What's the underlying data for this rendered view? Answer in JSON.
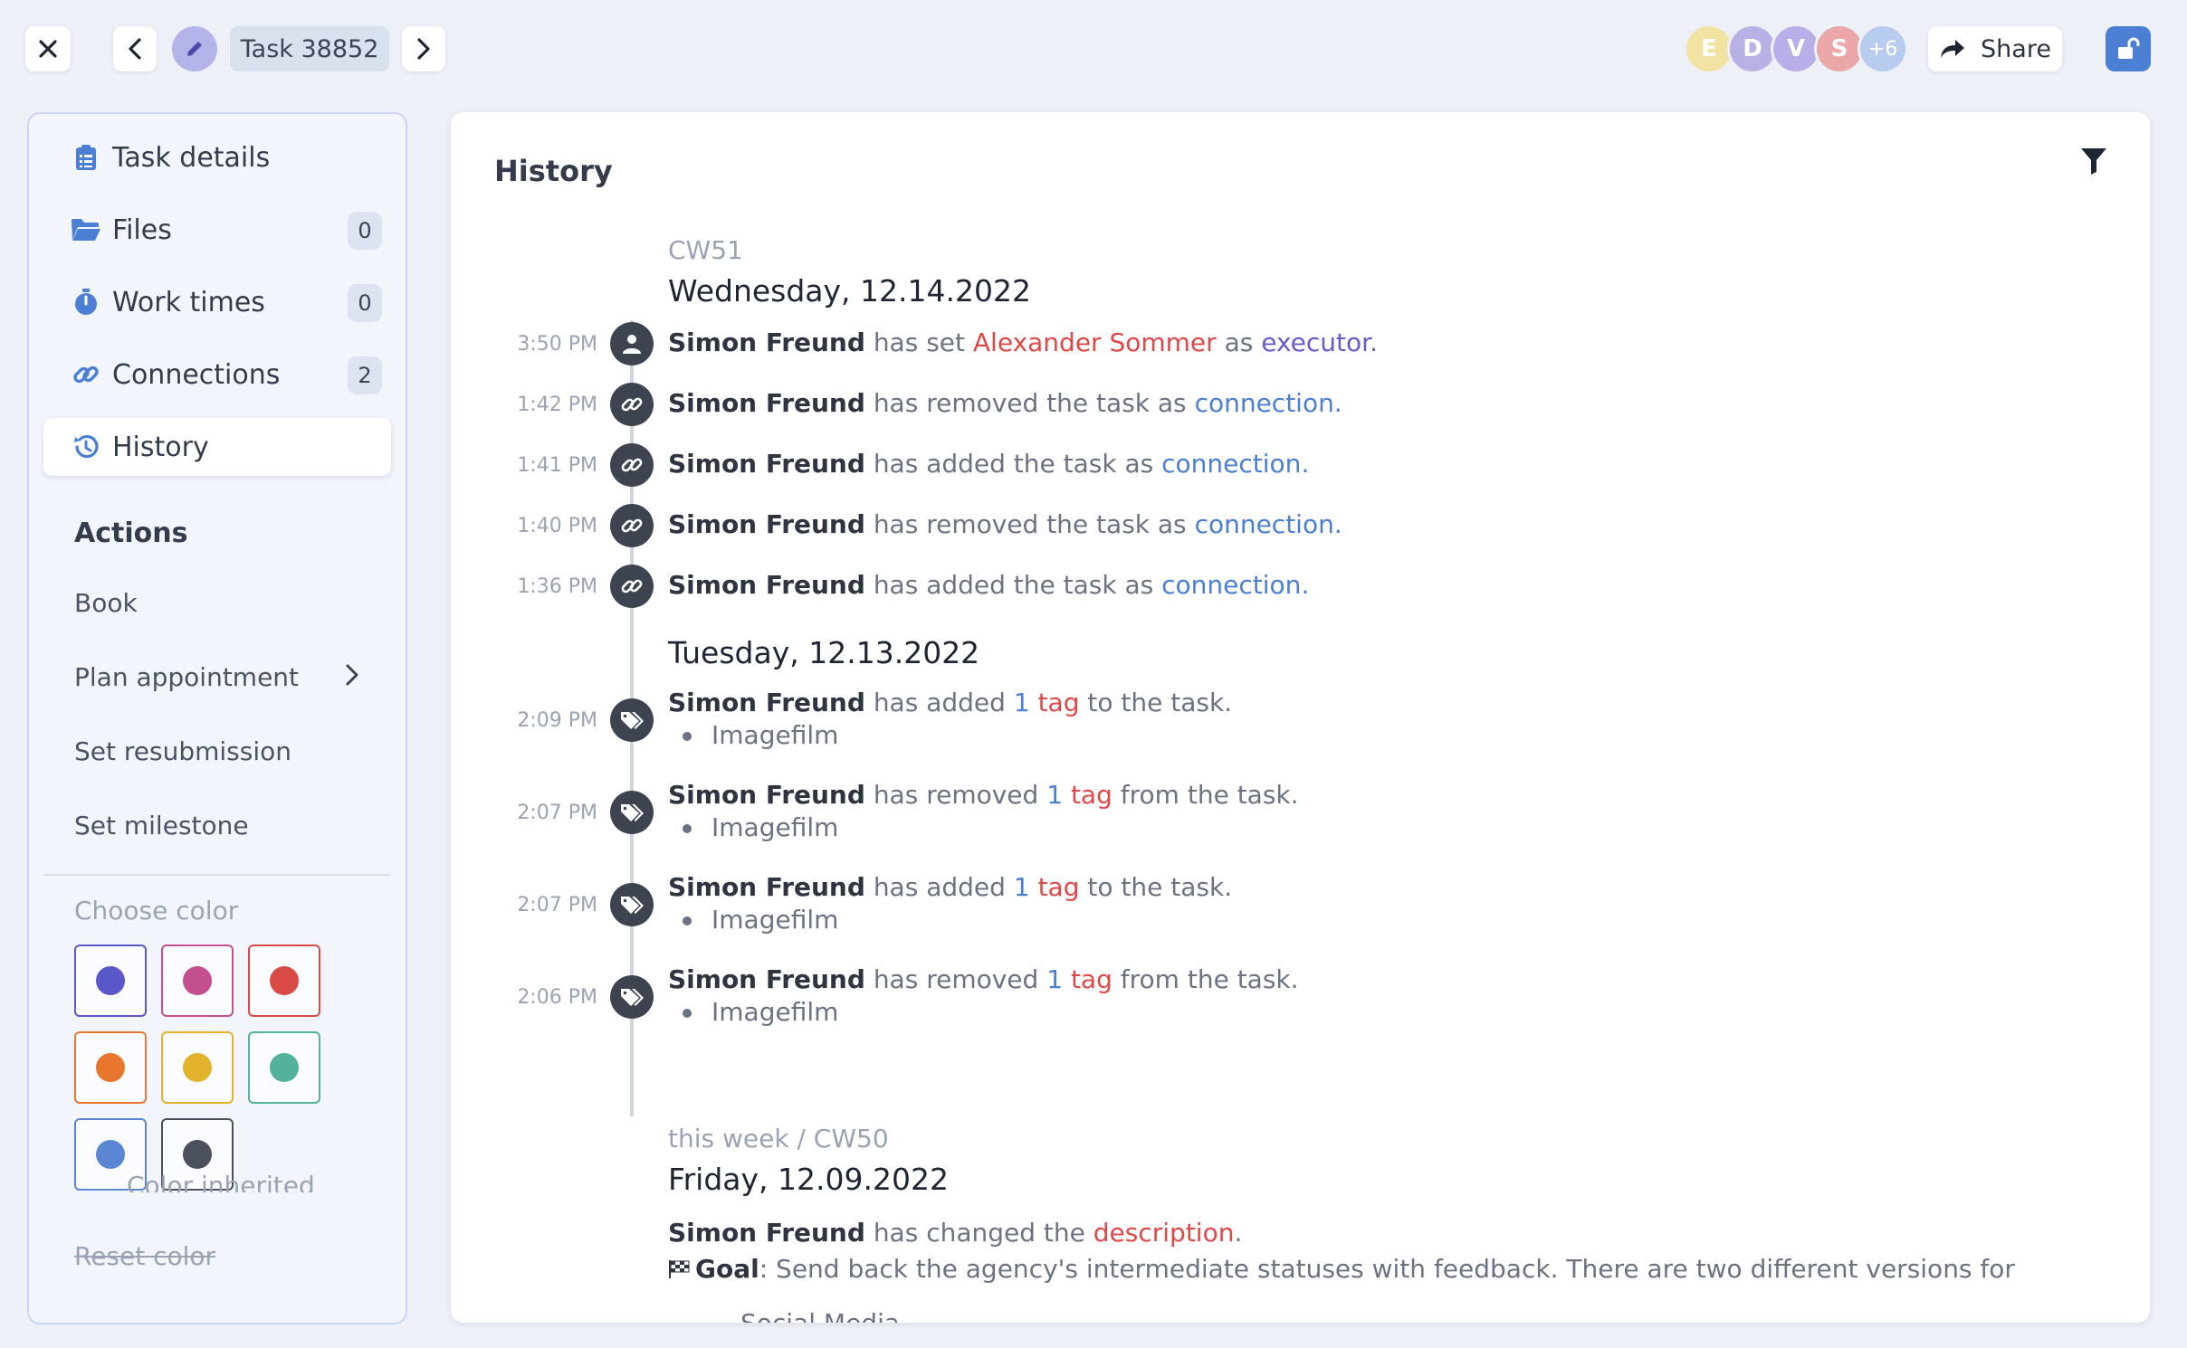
{
  "header": {
    "task_label": "Task 38852",
    "share_label": "Share",
    "avatars": [
      {
        "initial": "E",
        "color": "#f3e3a3"
      },
      {
        "initial": "D",
        "color": "#b8b1e6"
      },
      {
        "initial": "V",
        "color": "#b9aee8"
      },
      {
        "initial": "S",
        "color": "#eba7a7"
      },
      {
        "initial": "+6",
        "color": "#b8ccf0"
      }
    ]
  },
  "sidebar": {
    "nav": [
      {
        "label": "Task details",
        "count": null,
        "icon": "clipboard-icon"
      },
      {
        "label": "Files",
        "count": "0",
        "icon": "folder-icon"
      },
      {
        "label": "Work times",
        "count": "0",
        "icon": "stopwatch-icon"
      },
      {
        "label": "Connections",
        "count": "2",
        "icon": "link-icon"
      },
      {
        "label": "History",
        "count": null,
        "icon": "history-icon",
        "active": true
      }
    ],
    "actions_heading": "Actions",
    "actions": [
      "Book",
      "Plan appointment",
      "Set resubmission",
      "Set milestone"
    ],
    "choose_color_label": "Choose color",
    "colors": [
      "#5a57c9",
      "#c44f8f",
      "#d94a44",
      "#e9762e",
      "#e3b22d",
      "#52b39a",
      "#5b86d4",
      "#4a515c"
    ],
    "color_inherited_label": "Color inherited",
    "reset_color_label": "Reset color"
  },
  "main": {
    "title": "History",
    "groups": [
      {
        "week": "CW51",
        "days": [
          {
            "date": "Wednesday, 12.14.2022",
            "events": [
              {
                "time": "3:50 PM",
                "actor": "Simon Freund",
                "t1": "has set",
                "name": "Alexander Sommer",
                "t2": "as",
                "target": "executor",
                "end": "."
              },
              {
                "time": "1:42 PM",
                "actor": "Simon Freund",
                "t1": "has removed the task as",
                "target": "connection",
                "end": "."
              },
              {
                "time": "1:41 PM",
                "actor": "Simon Freund",
                "t1": "has added the task as",
                "target": "connection",
                "end": "."
              },
              {
                "time": "1:40 PM",
                "actor": "Simon Freund",
                "t1": "has removed the task as",
                "target": "connection",
                "end": "."
              },
              {
                "time": "1:36 PM",
                "actor": "Simon Freund",
                "t1": "has added the task as",
                "target": "connection",
                "end": "."
              }
            ]
          },
          {
            "date": "Tuesday, 12.13.2022",
            "events": [
              {
                "time": "2:09 PM",
                "actor": "Simon Freund",
                "t1": "has added",
                "num": "1",
                "word": "tag",
                "t2": "to the task.",
                "item": "Imagefilm"
              },
              {
                "time": "2:07 PM",
                "actor": "Simon Freund",
                "t1": "has removed",
                "num": "1",
                "word": "tag",
                "t2": "from the task.",
                "item": "Imagefilm"
              },
              {
                "time": "2:07 PM",
                "actor": "Simon Freund",
                "t1": "has added",
                "num": "1",
                "word": "tag",
                "t2": "to the task.",
                "item": "Imagefilm"
              },
              {
                "time": "2:06 PM",
                "actor": "Simon Freund",
                "t1": "has removed",
                "num": "1",
                "word": "tag",
                "t2": "from the task.",
                "item": "Imagefilm"
              }
            ]
          }
        ]
      },
      {
        "week": "this week / CW50",
        "days": [
          {
            "date": "Friday, 12.09.2022",
            "events": [
              {
                "actor": "Simon Freund",
                "t1": "has changed the",
                "target": "description",
                "end": ".",
                "goal_label": "Goal",
                "goal_text": ": Send back the agency's intermediate statuses with feedback. There are two different versions for",
                "clipped_line": "Social Media"
              }
            ]
          }
        ]
      }
    ]
  }
}
